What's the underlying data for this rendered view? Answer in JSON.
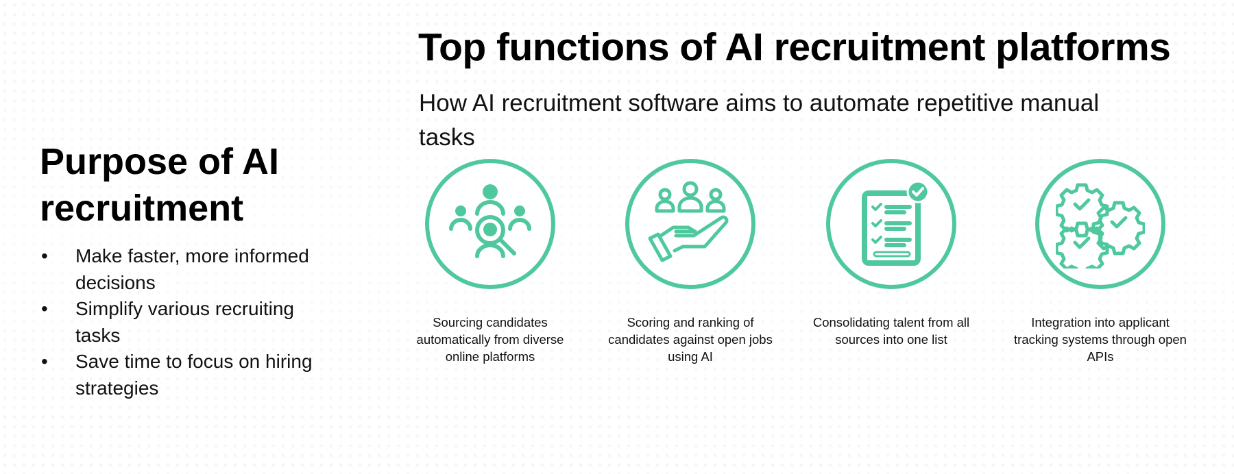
{
  "slide": {
    "title": "Top functions of AI recruitment platforms",
    "subtitle": "How AI recruitment software aims to automate repetitive manual tasks",
    "accent_color": "#4fc89e"
  },
  "left_panel": {
    "heading": "Purpose of AI recruitment",
    "bullet_glyph": "•",
    "bullets": [
      "Make faster, more informed decisions",
      "Simplify various recruiting tasks",
      "Save time to focus on hiring strategies"
    ]
  },
  "functions": [
    {
      "icon": "candidate-search-icon",
      "caption": "Sourcing candidates automatically from diverse online platforms"
    },
    {
      "icon": "hand-holding-people-icon",
      "caption": "Scoring and ranking of candidates against open jobs using AI"
    },
    {
      "icon": "checklist-icon",
      "caption": "Consolidating talent from all sources into one list"
    },
    {
      "icon": "gears-check-icon",
      "caption": "Integration into applicant tracking systems through open APIs"
    }
  ]
}
